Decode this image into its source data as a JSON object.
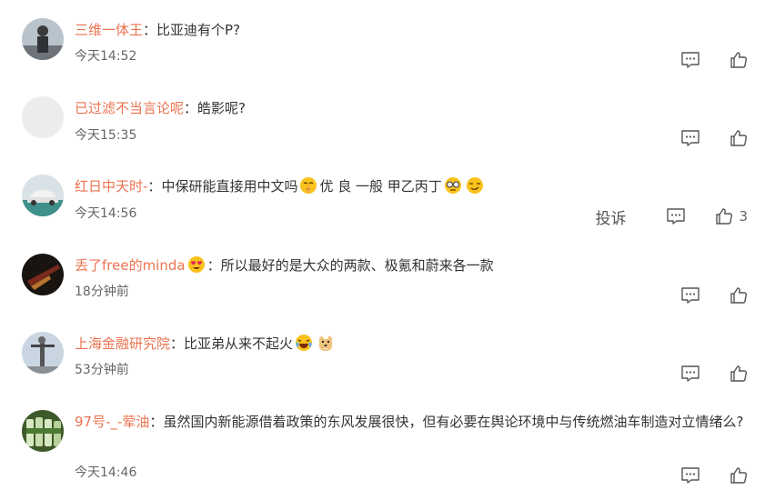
{
  "comments": [
    {
      "username": "三维一体王",
      "separator": "：",
      "text": "比亚迪有个P?",
      "time": "今天14:52",
      "avatar": "avatar-dark-figure"
    },
    {
      "username": "已过滤不当言论呢",
      "separator": "：",
      "text": "皓影呢?",
      "time": "今天15:35",
      "avatar": "avatar-blank"
    },
    {
      "username": "红日中天时-",
      "separator": "：",
      "text": "中保研能直接用中文吗",
      "text_part2": "优 良 一般 甲乙丙丁",
      "time": "今天14:56",
      "avatar": "avatar-car",
      "report_label": "投诉",
      "like_count": "3",
      "emoji": [
        "shushing-face-emoji",
        "goggle-face-emoji",
        "smirk-face-emoji"
      ]
    },
    {
      "username": "丢了free的minda",
      "separator": "：",
      "text": "所以最好的是大众的两款、极氪和蔚来各一款",
      "time": "18分钟前",
      "avatar": "avatar-dark-red",
      "emoji": [
        "heart-eyes-emoji"
      ]
    },
    {
      "username": "上海金融研究院",
      "separator": "：",
      "text": "比亚弟从来不起火",
      "time": "53分钟前",
      "avatar": "avatar-building",
      "emoji": [
        "laughing-tears-emoji",
        "doge-emoji"
      ]
    },
    {
      "username": "97号-_-荤油",
      "separator": "：",
      "text": "虽然国内新能源借着政策的东风发展很快，但有必要在舆论环境中与传统燃油车制造对立情绪么?",
      "time": "今天14:46",
      "avatar": "avatar-bottles"
    }
  ]
}
